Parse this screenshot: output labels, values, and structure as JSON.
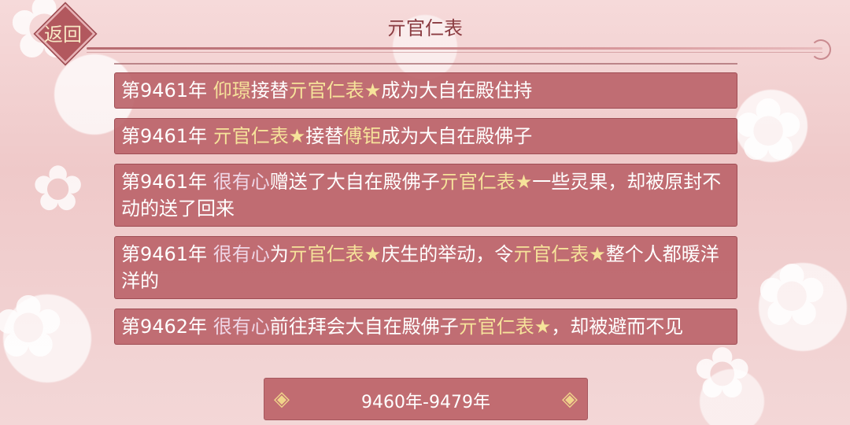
{
  "header": {
    "back_label": "返回",
    "title": "亓官仁表"
  },
  "events": [
    {
      "parts": [
        {
          "text": "第9461年 ",
          "color": "white"
        },
        {
          "text": "仰璟",
          "color": "yellow"
        },
        {
          "text": "接替",
          "color": "white"
        },
        {
          "text": "亓官仁表★",
          "color": "yellow"
        },
        {
          "text": "成为大自在殿住持",
          "color": "white"
        }
      ]
    },
    {
      "parts": [
        {
          "text": "第9461年 ",
          "color": "white"
        },
        {
          "text": "亓官仁表★",
          "color": "yellow"
        },
        {
          "text": "接替",
          "color": "white"
        },
        {
          "text": "傅钜",
          "color": "yellow"
        },
        {
          "text": "成为大自在殿佛子",
          "color": "white"
        }
      ]
    },
    {
      "parts": [
        {
          "text": "第9461年 ",
          "color": "white"
        },
        {
          "text": "很有心",
          "color": "lavender"
        },
        {
          "text": "赠送了大自在殿佛子",
          "color": "white"
        },
        {
          "text": "亓官仁表★",
          "color": "yellow"
        },
        {
          "text": "一些灵果，却被原封不动的送了回来",
          "color": "white"
        }
      ]
    },
    {
      "parts": [
        {
          "text": "第9461年 ",
          "color": "white"
        },
        {
          "text": "很有心",
          "color": "lavender"
        },
        {
          "text": "为",
          "color": "white"
        },
        {
          "text": "亓官仁表★",
          "color": "yellow"
        },
        {
          "text": "庆生的举动，令",
          "color": "white"
        },
        {
          "text": "亓官仁表★",
          "color": "yellow"
        },
        {
          "text": "整个人都暖洋洋的",
          "color": "white"
        }
      ]
    },
    {
      "parts": [
        {
          "text": "第9462年 ",
          "color": "white"
        },
        {
          "text": "很有心",
          "color": "lavender"
        },
        {
          "text": "前往拜会大自在殿佛子",
          "color": "white"
        },
        {
          "text": "亓官仁表★",
          "color": "yellow"
        },
        {
          "text": "，却被避而不见",
          "color": "white"
        }
      ]
    }
  ],
  "footer": {
    "range_label": "9460年-9479年",
    "prev_icon": "left-ornament-arrow-icon",
    "next_icon": "right-ornament-arrow-icon"
  },
  "colors": {
    "accent": "#b2585e",
    "highlight_name": "#f6e39a",
    "actor_name": "#efd6e6",
    "title_text": "#8a3b41"
  }
}
